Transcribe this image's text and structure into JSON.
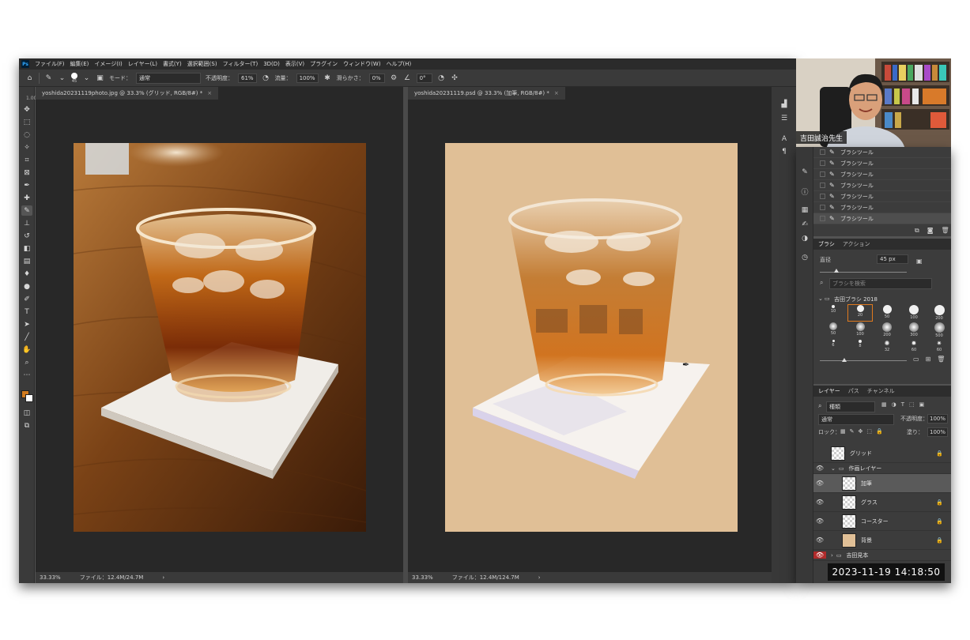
{
  "app": {
    "logo": "Ps",
    "menu": [
      "ファイル(F)",
      "編集(E)",
      "イメージ(I)",
      "レイヤー(L)",
      "書式(Y)",
      "選択範囲(S)",
      "フィルター(T)",
      "3D(D)",
      "表示(V)",
      "プラグイン",
      "ウィンドウ(W)",
      "ヘルプ(H)"
    ]
  },
  "options": {
    "brush_size": "45",
    "mode_label": "モード：",
    "mode_value": "通常",
    "opacity_label": "不透明度：",
    "opacity_value": "61%",
    "flow_label": "流量：",
    "flow_value": "100%",
    "smoothing_label": "滑らかさ：",
    "smoothing_value": "0%",
    "angle_value": "0°"
  },
  "toolbar": {
    "zoom_hint": "1.00",
    "icons": [
      "move-icon",
      "marquee-icon",
      "lasso-icon",
      "magic-wand-icon",
      "crop-icon",
      "frame-icon",
      "eyedropper-icon",
      "healing-icon",
      "brush-icon",
      "stamp-icon",
      "history-brush-icon",
      "eraser-icon",
      "gradient-icon",
      "blur-icon",
      "dodge-icon",
      "pen-icon",
      "type-icon",
      "path-select-icon",
      "line-icon",
      "hand-icon",
      "zoom-icon",
      "more-icon"
    ],
    "foreground_color": "#d07a1e",
    "background_color": "#ffffff"
  },
  "docs": {
    "left": {
      "tab": "yoshida20231119photo.jpg @ 33.3% (グリッド, RGB/8#) *",
      "zoom": "33.33%",
      "file": "ファイル：12.4M/24.7M"
    },
    "right": {
      "tab": "yoshida20231119.psd @ 33.3% (加筆, RGB/8#) *",
      "zoom": "33.33%",
      "file": "ファイル：12.4M/124.7M"
    }
  },
  "history": {
    "items": [
      "ブラシツール",
      "ブラシツール",
      "ブラシツール",
      "ブラシツール",
      "ブラシツール",
      "ブラシツール",
      "ブラシツール"
    ]
  },
  "brush_panel": {
    "tabs": [
      "ブラシ",
      "アクション"
    ],
    "size_label": "直径",
    "size_value": "45 px",
    "search_placeholder": "ブラシを検索",
    "group_name": "吉田ブラシ 2018",
    "presets": [
      "10",
      "20",
      "50",
      "100",
      "200",
      "50",
      "100",
      "200",
      "300",
      "500",
      "6",
      "8",
      "32",
      "60",
      "60"
    ]
  },
  "layers_panel": {
    "tabs": [
      "レイヤー",
      "パス",
      "チャンネル"
    ],
    "filter_label": "種類",
    "blend_mode": "通常",
    "opacity_label": "不透明度：",
    "opacity_value": "100%",
    "lock_label": "ロック：",
    "fill_label": "塗り：",
    "fill_value": "100%",
    "layers": [
      "グリッド",
      "作画レイヤー",
      "加筆",
      "グラス",
      "コースター",
      "背景",
      "吉田見本"
    ]
  },
  "webcam": {
    "caption": "吉田誠治先生"
  },
  "timestamp": "2023-11-19  14:18:50",
  "colors": {
    "ui_dark": "#535353",
    "canvas_bg": "#282828",
    "accent_orange": "#d07a1e",
    "paint_bg": "#e0bf96"
  }
}
